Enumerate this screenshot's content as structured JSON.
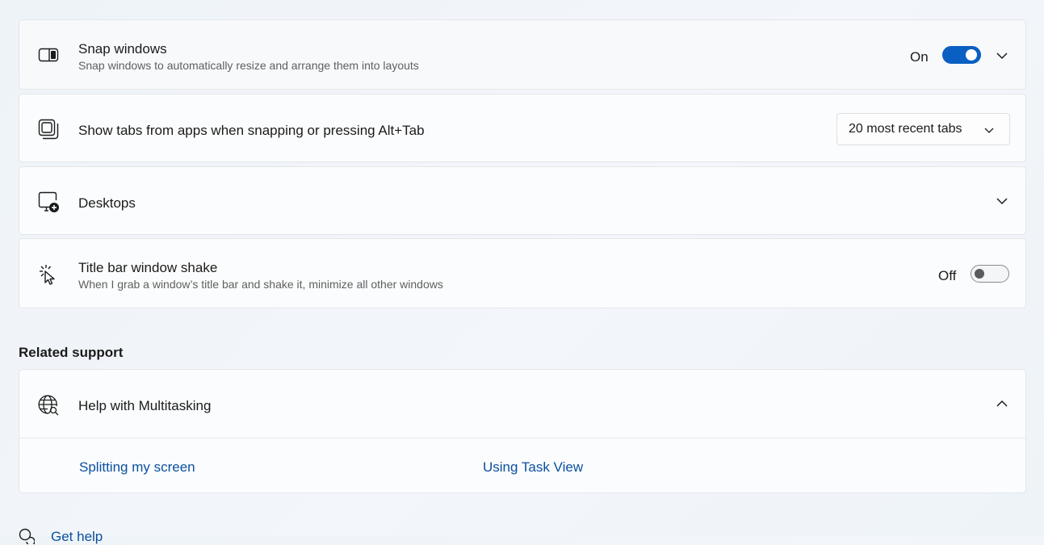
{
  "snap_windows": {
    "title": "Snap windows",
    "subtitle": "Snap windows to automatically resize and arrange them into layouts",
    "toggle_state": "On",
    "toggle_on": true,
    "icon": "snap-layout-icon",
    "expander": "chevron-down-icon"
  },
  "show_tabs": {
    "title": "Show tabs from apps when snapping or pressing Alt+Tab",
    "selected_option": "20 most recent tabs",
    "icon": "stacked-windows-icon"
  },
  "desktops": {
    "title": "Desktops",
    "icon": "desktop-add-icon",
    "expander": "chevron-down-icon"
  },
  "title_bar_shake": {
    "title": "Title bar window shake",
    "subtitle": "When I grab a window’s title bar and shake it, minimize all other windows",
    "toggle_state": "Off",
    "toggle_on": false,
    "icon": "shake-cursor-icon"
  },
  "related_support": {
    "heading": "Related support",
    "help_title": "Help with Multitasking",
    "icon": "globe-search-icon",
    "expander": "chevron-up-icon",
    "links": [
      "Splitting my screen",
      "Using Task View"
    ]
  },
  "get_help": {
    "label": "Get help",
    "icon": "help-chat-icon"
  },
  "colors": {
    "accent": "#0a5fc2",
    "link": "#0a4f9e"
  }
}
